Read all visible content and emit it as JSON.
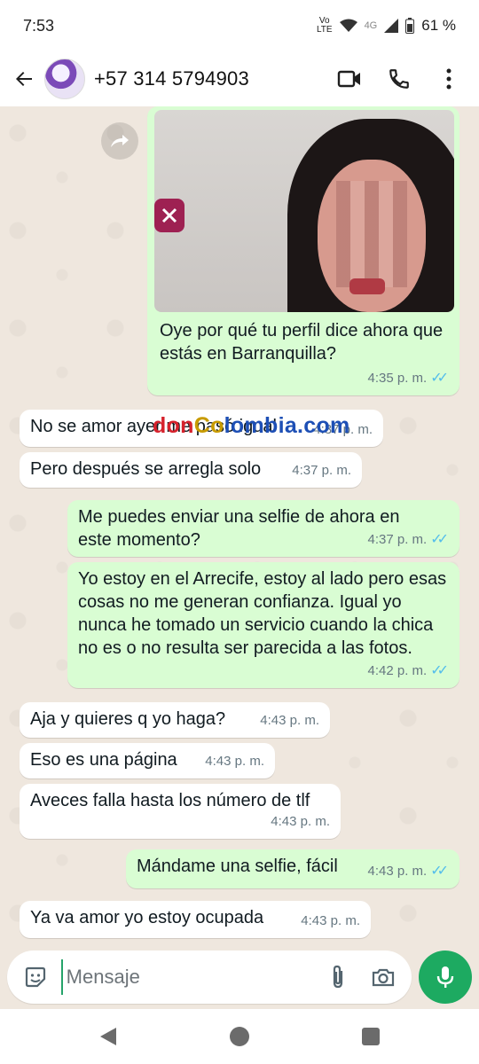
{
  "status": {
    "time": "7:53",
    "network_top": "Vo",
    "network_bottom": "LTE",
    "signal_label": "4G",
    "battery": "61 %"
  },
  "header": {
    "contact_name": "+57 314 5794903",
    "icons": [
      "back-arrow-icon",
      "video-call-icon",
      "phone-icon",
      "more-vert-icon"
    ]
  },
  "watermark": {
    "part1": "don",
    "part2": "Co",
    "part3": "lombia.com"
  },
  "messages": [
    {
      "dir": "out",
      "text": "Oye por qué tu perfil dice ahora que estás en Barranquilla?",
      "time": "4:35 p. m.",
      "ticks": "✓✓",
      "has_image": true
    },
    {
      "dir": "in",
      "text": "No se amor ayer me pasó igual",
      "time": "4:37 p. m."
    },
    {
      "dir": "in",
      "text": "Pero después se arregla solo",
      "time": "4:37 p. m."
    },
    {
      "dir": "out",
      "text": "Me puedes enviar una selfie de ahora en este momento?",
      "time": "4:37 p. m.",
      "ticks": "✓✓"
    },
    {
      "dir": "out",
      "text": "Yo estoy en el Arrecife, estoy al lado pero esas cosas no me generan confianza. Igual yo nunca he tomado un servicio cuando la chica no es o no resulta ser parecida a las fotos.",
      "time": "4:42 p. m.",
      "ticks": "✓✓"
    },
    {
      "dir": "in",
      "text": "Aja y quieres q yo haga?",
      "time": "4:43 p. m."
    },
    {
      "dir": "in",
      "text": "Eso es una página",
      "time": "4:43 p. m."
    },
    {
      "dir": "in",
      "text": "Aveces falla hasta los número de tlf",
      "time": "4:43 p. m."
    },
    {
      "dir": "out",
      "text": "Mándame una selfie, fácil",
      "time": "4:43 p. m.",
      "ticks": "✓✓"
    },
    {
      "dir": "in",
      "text": "Ya va amor yo estoy ocupada",
      "time": "4:43 p. m."
    }
  ],
  "composer": {
    "placeholder": "Mensaje"
  },
  "colors": {
    "outgoing_bubble": "#d9fdd3",
    "incoming_bubble": "#ffffff",
    "read_ticks": "#53bdeb",
    "accent_green": "#1daa61"
  }
}
